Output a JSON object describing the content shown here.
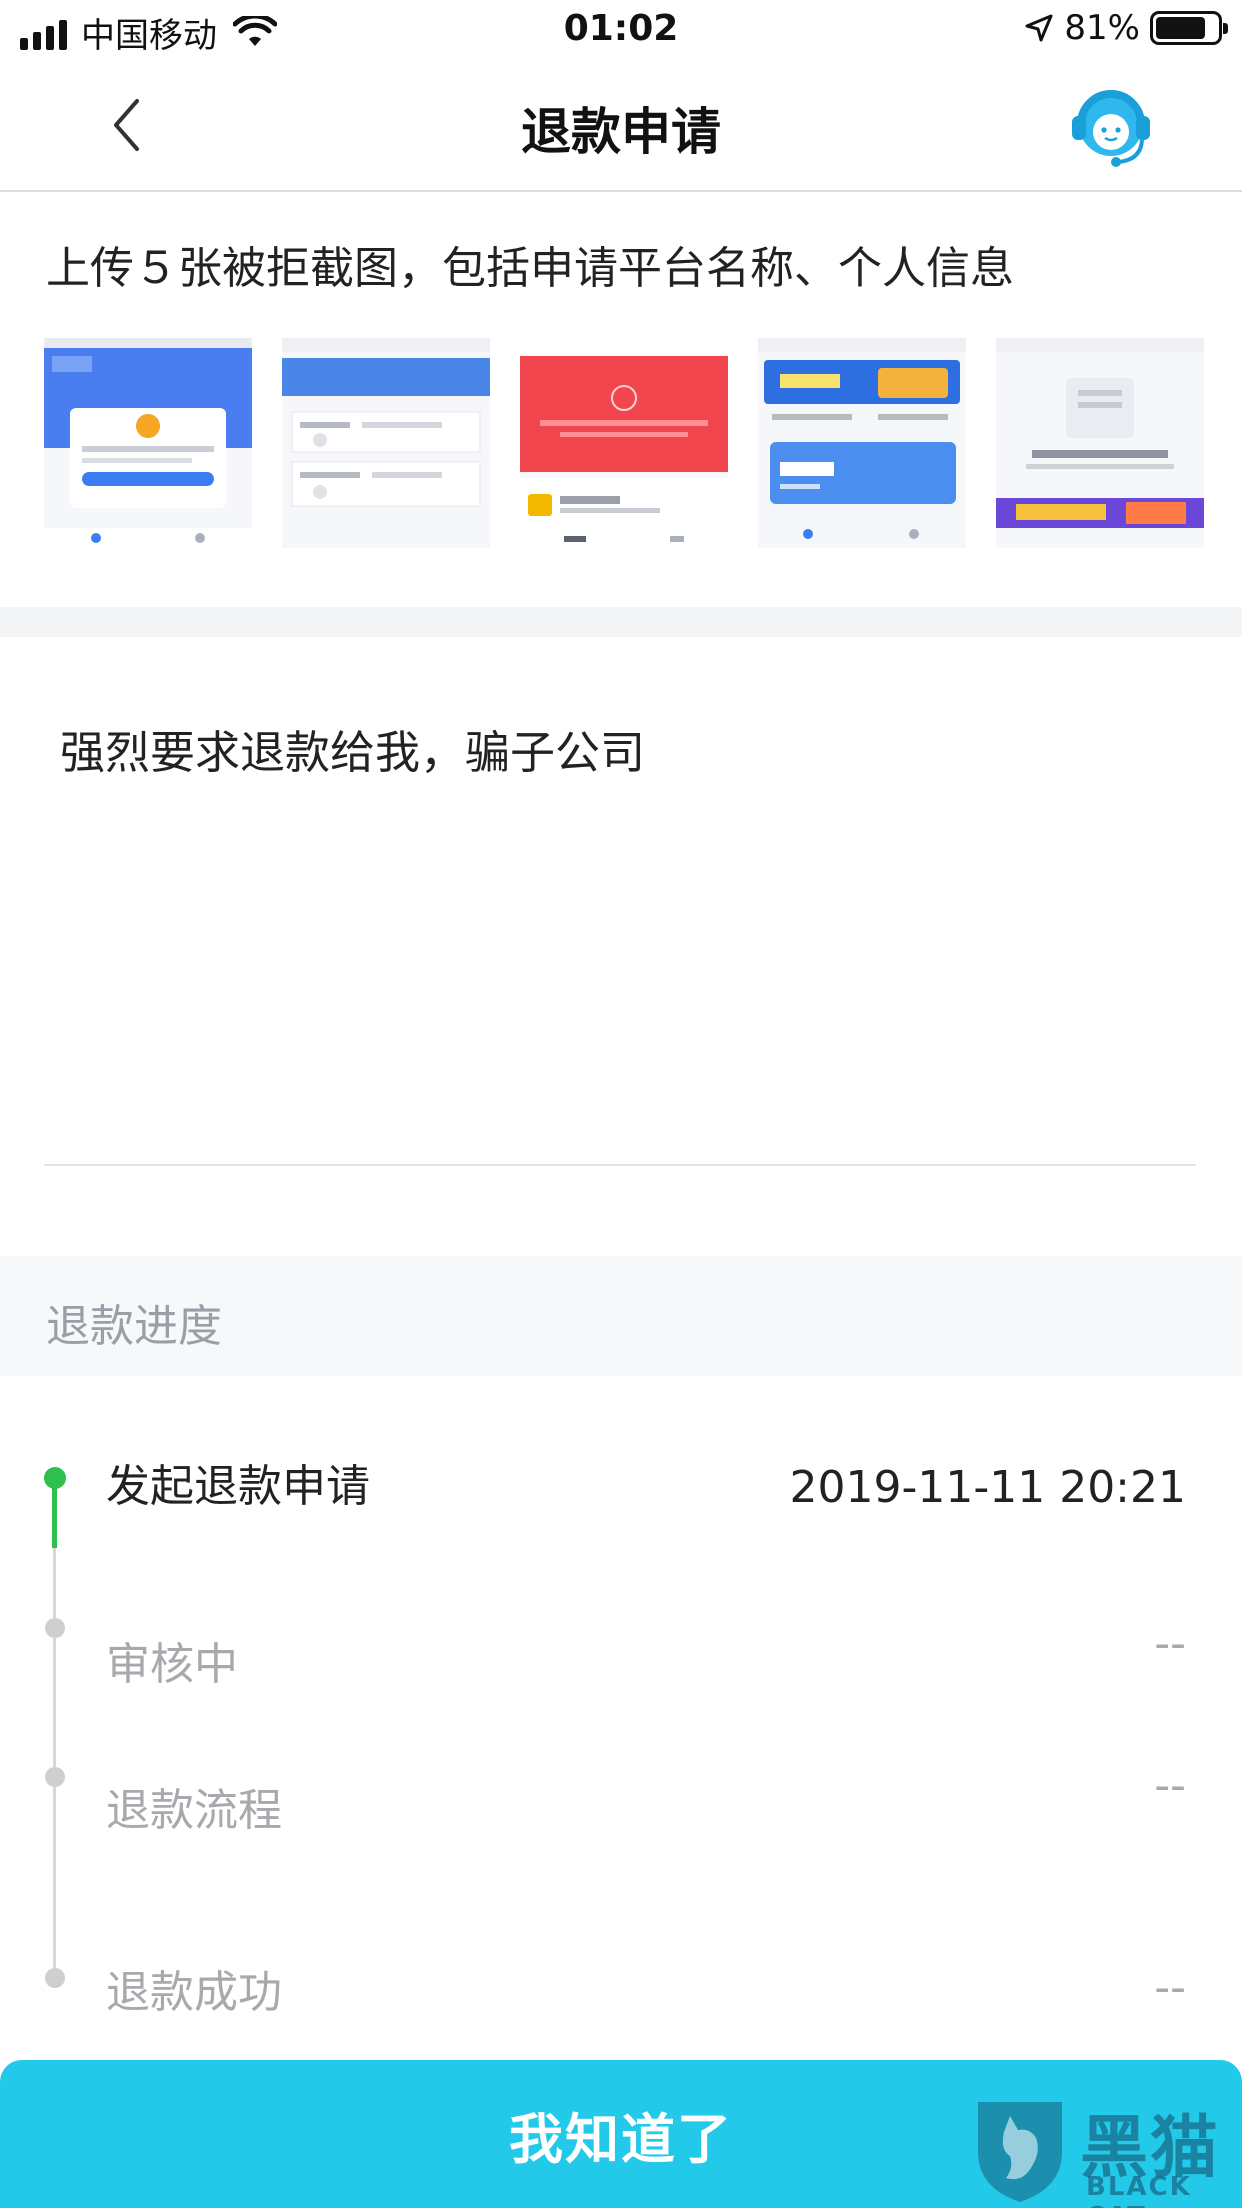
{
  "status_bar": {
    "carrier": "中国移动",
    "time": "01:02",
    "battery": "81%",
    "battery_level": 0.81
  },
  "nav": {
    "title": "退款申请",
    "back_icon": "chevron-left-icon",
    "support_icon": "customer-service-headset-icon"
  },
  "upload": {
    "hint": "上传５张被拒截图，包括申请平台名称、个人信息",
    "screenshots": [
      {
        "caption": "",
        "accent": "#4a7ef0"
      },
      {
        "caption": "",
        "accent": "#4a86e8"
      },
      {
        "caption": "",
        "accent": "#f2464e"
      },
      {
        "caption": "",
        "accent": "#2d6fe0"
      },
      {
        "caption": "",
        "accent": "#e9edf3"
      }
    ]
  },
  "reason": {
    "text": "强烈要求退款给我，骗子公司"
  },
  "progress": {
    "title": "退款进度",
    "steps": [
      {
        "label": "发起退款申请",
        "time": "2019-11-11 20:21",
        "done": true
      },
      {
        "label": "审核中",
        "time": "--",
        "done": false
      },
      {
        "label": "退款流程",
        "time": "--",
        "done": false
      },
      {
        "label": "退款成功",
        "time": "--",
        "done": false
      }
    ]
  },
  "footer": {
    "button_label": "我知道了"
  },
  "watermark": {
    "cn": "黑猫",
    "en": "BLACK CAT"
  },
  "colors": {
    "accent": "#22c9e9",
    "progress_done": "#2fbf4c",
    "progress_pending": "#cfcfcf"
  }
}
